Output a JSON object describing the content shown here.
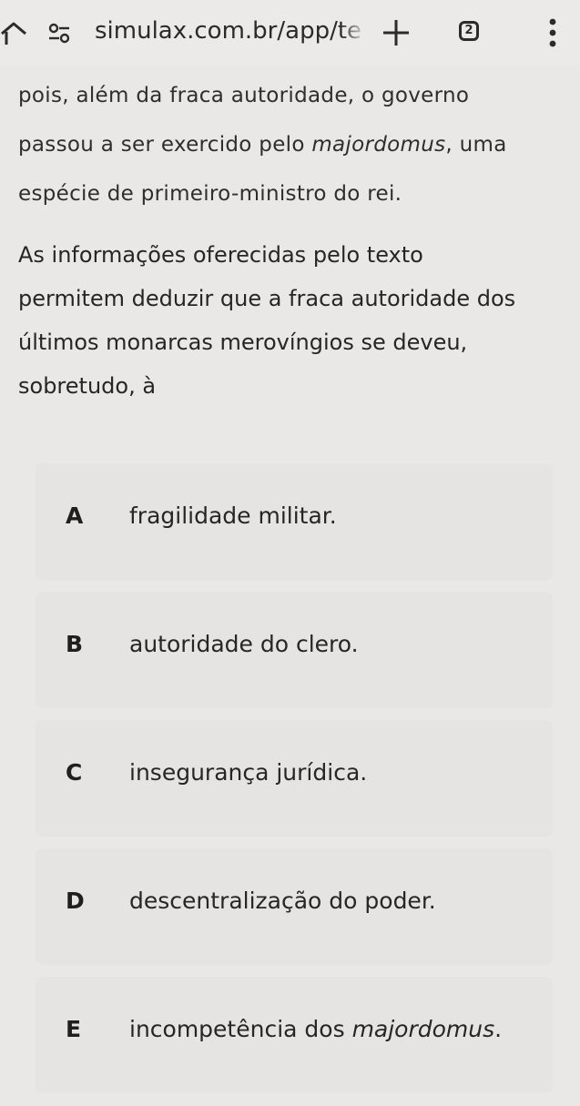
{
  "browser": {
    "url": "simulax.com.br/app/te",
    "tab_count": "2",
    "icons": {
      "home": "home-icon",
      "site_settings": "site-settings-icon",
      "new_tab": "plus-icon",
      "tabs": "tabs-count-icon",
      "menu": "more-vertical-icon"
    }
  },
  "passage": {
    "line1": "pois, além da fraca autoridade, o governo",
    "line2_before": "passou a ser exercido pelo ",
    "line2_italic": "majordomus",
    "line2_after": ", uma",
    "line3": "espécie de primeiro-ministro do rei."
  },
  "question": {
    "line1": "As informações oferecidas pelo texto",
    "line2": "permitem deduzir que a fraca autoridade dos",
    "line3": "últimos monarcas merovíngios se deveu,",
    "line4": "sobretudo, à"
  },
  "options": [
    {
      "letter": "A",
      "text": "fragilidade militar."
    },
    {
      "letter": "B",
      "text": "autoridade do clero."
    },
    {
      "letter": "C",
      "text": "insegurança jurídica."
    },
    {
      "letter": "D",
      "text": "descentralização do poder."
    },
    {
      "letter": "E",
      "text_before": "incompetência dos ",
      "text_italic": "majordomus",
      "text_after": "."
    }
  ]
}
